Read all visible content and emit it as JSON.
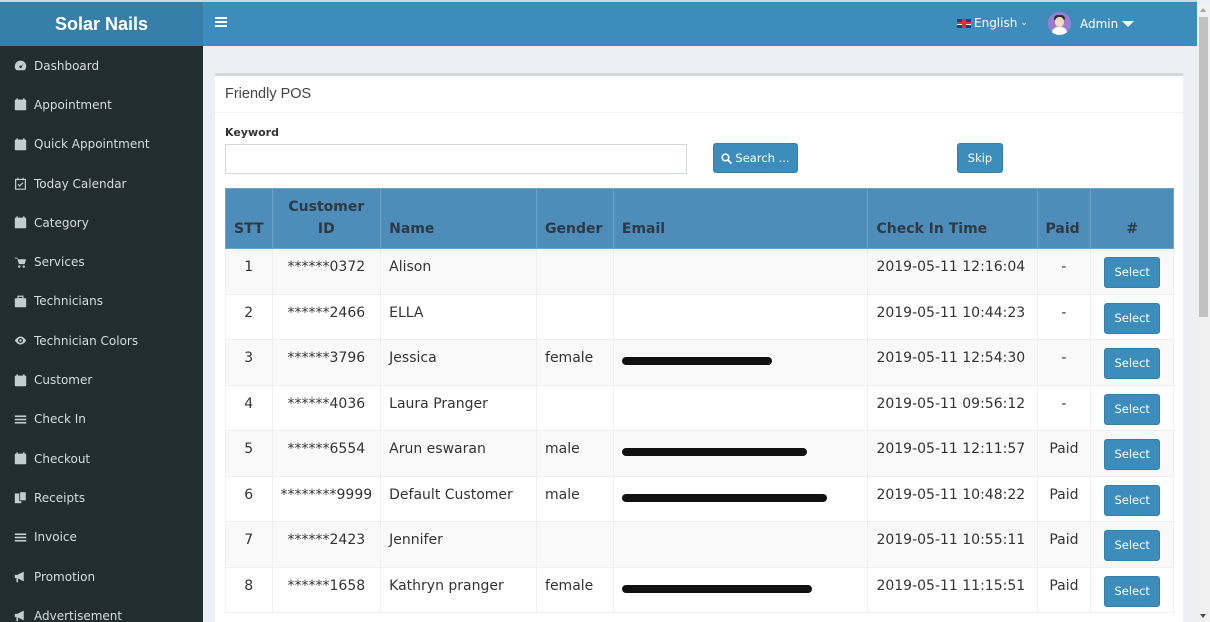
{
  "app": {
    "logo": "Solar Nails"
  },
  "sidebar": {
    "items": [
      {
        "label": "Dashboard",
        "icon": "dashboard-icon"
      },
      {
        "label": "Appointment",
        "icon": "calendar-icon"
      },
      {
        "label": "Quick Appointment",
        "icon": "calendar-icon"
      },
      {
        "label": "Today Calendar",
        "icon": "calendar-check-icon"
      },
      {
        "label": "Category",
        "icon": "calendar-icon"
      },
      {
        "label": "Services",
        "icon": "cart-icon"
      },
      {
        "label": "Technicians",
        "icon": "briefcase-icon"
      },
      {
        "label": "Technician Colors",
        "icon": "eye-icon"
      },
      {
        "label": "Customer",
        "icon": "calendar-icon"
      },
      {
        "label": "Check In",
        "icon": "bars-icon"
      },
      {
        "label": "Checkout",
        "icon": "calendar-icon"
      },
      {
        "label": "Receipts",
        "icon": "copy-icon"
      },
      {
        "label": "Invoice",
        "icon": "bars-icon"
      },
      {
        "label": "Promotion",
        "icon": "bullhorn-icon"
      },
      {
        "label": "Advertisement",
        "icon": "bullhorn-icon"
      }
    ]
  },
  "header": {
    "language": "English",
    "user": "Admin"
  },
  "main": {
    "title": "Friendly POS",
    "keyword_label": "Keyword",
    "keyword_value": "",
    "search_label": "Search ...",
    "skip_label": "Skip",
    "table": {
      "headers": [
        "STT",
        "Customer ID",
        "Name",
        "Gender",
        "Email",
        "Check In Time",
        "Paid",
        "#"
      ],
      "rows": [
        {
          "stt": "1",
          "customer_id": "******0372",
          "name": "Alison",
          "gender": "",
          "email_redacted": false,
          "check_in": "2019-05-11 12:16:04",
          "paid": "-",
          "action": "Select"
        },
        {
          "stt": "2",
          "customer_id": "******2466",
          "name": "ELLA",
          "gender": "",
          "email_redacted": false,
          "check_in": "2019-05-11 10:44:23",
          "paid": "-",
          "action": "Select"
        },
        {
          "stt": "3",
          "customer_id": "******3796",
          "name": "Jessica",
          "gender": "female",
          "email_redacted": true,
          "check_in": "2019-05-11 12:54:30",
          "paid": "-",
          "action": "Select"
        },
        {
          "stt": "4",
          "customer_id": "******4036",
          "name": "Laura Pranger",
          "gender": "",
          "email_redacted": false,
          "check_in": "2019-05-11 09:56:12",
          "paid": "-",
          "action": "Select"
        },
        {
          "stt": "5",
          "customer_id": "******6554",
          "name": "Arun eswaran",
          "gender": "male",
          "email_redacted": true,
          "check_in": "2019-05-11 12:11:57",
          "paid": "Paid",
          "action": "Select"
        },
        {
          "stt": "6",
          "customer_id": "********9999",
          "name": "Default Customer",
          "gender": "male",
          "email_redacted": true,
          "check_in": "2019-05-11 10:48:22",
          "paid": "Paid",
          "action": "Select"
        },
        {
          "stt": "7",
          "customer_id": "******2423",
          "name": "Jennifer",
          "gender": "",
          "email_redacted": false,
          "check_in": "2019-05-11 10:55:11",
          "paid": "Paid",
          "action": "Select"
        },
        {
          "stt": "8",
          "customer_id": "******1658",
          "name": "Kathryn pranger",
          "gender": "female",
          "email_redacted": true,
          "check_in": "2019-05-11 11:15:51",
          "paid": "Paid",
          "action": "Select"
        }
      ]
    }
  },
  "colors": {
    "header": "#3c8dbc",
    "logo_bg": "#367fa9",
    "sidebar": "#222d32",
    "table_header": "#4e8cb9",
    "button": "#3c8dbc"
  }
}
